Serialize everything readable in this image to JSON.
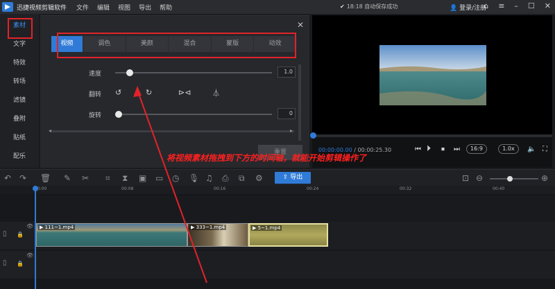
{
  "app": {
    "title": "迅捷视频剪辑软件"
  },
  "menu": [
    "文件",
    "编辑",
    "视图",
    "导出",
    "帮助"
  ],
  "status": {
    "save_text": "18:18 自动保存成功"
  },
  "account": {
    "login_label": "登录/注册"
  },
  "sidebar": {
    "items": [
      "素材",
      "文字",
      "特效",
      "转场",
      "滤镜",
      "叠附",
      "贴纸",
      "配乐"
    ],
    "active": "素材"
  },
  "panel": {
    "tabs": [
      "视频",
      "调色",
      "美颜",
      "混合",
      "蒙版",
      "动效"
    ],
    "active_tab": "视频",
    "speed": {
      "label": "速度",
      "value": "1.0",
      "level": 0.07
    },
    "flip": {
      "label": "翻转"
    },
    "rotate": {
      "label": "旋转",
      "value": "0",
      "level": 0.0
    },
    "reset_label": "重置"
  },
  "preview": {
    "current_time": "00:00:00.00",
    "total_time": " / 00:00:25.30",
    "aspect": "16:9",
    "speed": "1.0x",
    "progress": 0.0
  },
  "toolbar": {
    "export_label": "导出"
  },
  "ruler": {
    "ticks": [
      "00:00",
      "00:08",
      "00:16",
      "00:24",
      "00:32",
      "00:40"
    ]
  },
  "timeline": {
    "clips": [
      {
        "name": "111~1.mp4"
      },
      {
        "name": "333~1.mp4"
      },
      {
        "name": "5~1.mp4"
      }
    ]
  },
  "annotation": {
    "text": "将视频素材拖拽到下方的时间轴，就能开始剪辑操作了"
  },
  "colors": {
    "accent": "#2f7bd7",
    "highlight": "#e2232a",
    "annotation": "#ff2020"
  }
}
